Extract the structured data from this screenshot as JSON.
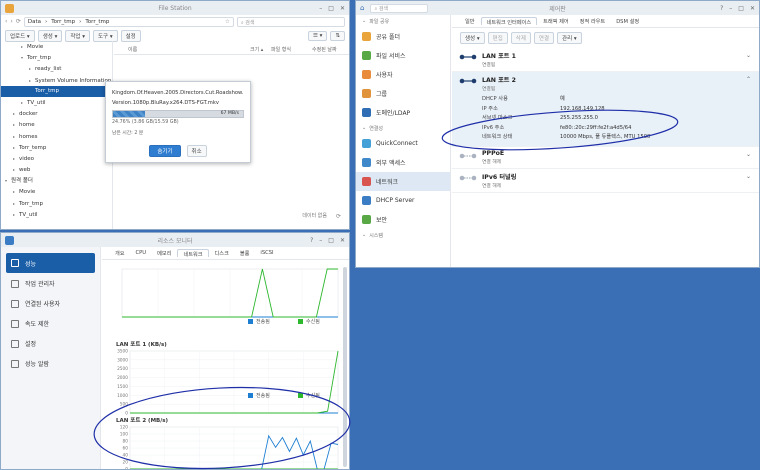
{
  "file_station": {
    "title": "File Station",
    "path": [
      "Data",
      "Torr_tmp",
      "Torr_tmp"
    ],
    "search_placeholder": "검색",
    "toolbar": [
      "업로드 ▾",
      "생성 ▾",
      "작업 ▾",
      "도구 ▾",
      "설정"
    ],
    "columns": [
      "이름",
      "크기 ▴",
      "파일 형식",
      "수정된 날짜"
    ],
    "tree": [
      {
        "label": "Movie",
        "indent": 1,
        "arrow": "▸"
      },
      {
        "label": "Torr_tmp",
        "indent": 1,
        "arrow": "▾"
      },
      {
        "label": "ready_list",
        "indent": 2,
        "arrow": "▸"
      },
      {
        "label": "System Volume Information",
        "indent": 2,
        "arrow": "▸"
      },
      {
        "label": "Torr_tmp",
        "indent": 2,
        "arrow": "",
        "selected": true
      },
      {
        "label": "TV_util",
        "indent": 1,
        "arrow": "▸"
      },
      {
        "label": "docker",
        "indent": 0,
        "arrow": "▸"
      },
      {
        "label": "home",
        "indent": 0,
        "arrow": "▸"
      },
      {
        "label": "homes",
        "indent": 0,
        "arrow": "▸"
      },
      {
        "label": "Torr_temp",
        "indent": 0,
        "arrow": "▸"
      },
      {
        "label": "video",
        "indent": 0,
        "arrow": "▸"
      },
      {
        "label": "web",
        "indent": 0,
        "arrow": "▸"
      },
      {
        "label": "원격 폴더",
        "indent": -1,
        "arrow": "▾"
      },
      {
        "label": "Movie",
        "indent": 0,
        "arrow": "▸"
      },
      {
        "label": "Torr_tmp",
        "indent": 0,
        "arrow": "▸"
      },
      {
        "label": "TV_util",
        "indent": 0,
        "arrow": "▸"
      }
    ],
    "footer": "데이터 없음",
    "dialog": {
      "filename": "Kingdom.Of.Heaven.2005.Directors.Cut.Roadshow.Version.1080p.BluRay.x264.DTS-FGT.mkv",
      "progress": 0.2476,
      "progress_text": "24.76% (3.86 GB/15.59 GB)",
      "speed": "67 MB/s",
      "remaining": "남은 시간: 2 분",
      "hide": "숨기기",
      "cancel": "취소"
    }
  },
  "control_panel": {
    "title": "제어판",
    "search_placeholder": "검색",
    "sidebar": [
      {
        "label": "파일 공유",
        "section": true
      },
      {
        "label": "공유 폴더",
        "color": "#e9a43b"
      },
      {
        "label": "파일 서비스",
        "color": "#58a845"
      },
      {
        "label": "사용자",
        "color": "#e88b3a"
      },
      {
        "label": "그룹",
        "color": "#e0933b"
      },
      {
        "label": "도메인/LDAP",
        "color": "#2f6eb5"
      },
      {
        "label": "연결성",
        "section": true
      },
      {
        "label": "QuickConnect",
        "color": "#44a1d8"
      },
      {
        "label": "외부 액세스",
        "color": "#3f88c9"
      },
      {
        "label": "네트워크",
        "color": "#d9534f",
        "selected": true
      },
      {
        "label": "DHCP Server",
        "color": "#3b7dc4"
      },
      {
        "label": "보안",
        "color": "#58a845"
      },
      {
        "label": "시스템",
        "section": true
      }
    ],
    "tabs": [
      "일반",
      "네트워크 인터페이스",
      "트래픽 제어",
      "정적 라우트",
      "DSM 설정"
    ],
    "actions": [
      "생성 ▾",
      "편집",
      "삭제",
      "연결",
      "관리 ▾"
    ],
    "interfaces": [
      {
        "name": "LAN 포트 1",
        "status": "연결됨",
        "expanded": false
      },
      {
        "name": "LAN 포트 2",
        "status": "연결됨",
        "expanded": true,
        "details": [
          {
            "k": "DHCP 사용",
            "v": "예"
          },
          {
            "k": "IP 주소",
            "v": "192.168.149.128"
          },
          {
            "k": "서브넷 마스크",
            "v": "255.255.255.0"
          },
          {
            "k": "IPv6 주소",
            "v": "fe80::20c:29ff:fe2f:a4d5/64"
          },
          {
            "k": "네트워크 상태",
            "v": "10000 Mbps, 풀 듀플렉스, MTU 1500"
          }
        ]
      },
      {
        "name": "PPPoE",
        "status": "연결 해제",
        "expanded": false
      },
      {
        "name": "IPv6 터널링",
        "status": "연결 해제",
        "expanded": false
      }
    ]
  },
  "resource_monitor": {
    "title": "리소스 모니터",
    "sidebar": [
      "성능",
      "작업 관리자",
      "연결된 사용자",
      "속도 제한",
      "설정",
      "성능 알람"
    ],
    "tabs": [
      "개요",
      "CPU",
      "메모리",
      "네트워크",
      "디스크",
      "볼륨",
      "iSCSI"
    ],
    "legend": {
      "send": "전송됨",
      "recv": "수신됨"
    },
    "colors": {
      "send": "#1e7fd2",
      "recv": "#2eb82e"
    }
  },
  "chart_data": [
    {
      "type": "line",
      "title": "",
      "x": [
        0,
        1,
        2,
        3,
        4,
        5,
        6,
        7,
        8,
        9,
        10,
        11,
        12,
        13,
        14,
        15,
        16,
        17,
        18,
        19,
        20
      ],
      "series": [
        {
          "name": "전송됨",
          "values": [
            0,
            0,
            0,
            0,
            0,
            0,
            0,
            0,
            0,
            0,
            0,
            0,
            0,
            0,
            0,
            0,
            0,
            0,
            0,
            0,
            0
          ]
        },
        {
          "name": "수신됨",
          "values": [
            0,
            0,
            0,
            0,
            0,
            0,
            0,
            0,
            0,
            0,
            0,
            0,
            0,
            1,
            0,
            0,
            0,
            0,
            0,
            1,
            1
          ]
        }
      ]
    },
    {
      "type": "line",
      "title": "LAN 포트 1 (KB/s)",
      "yticks": [
        0,
        500,
        1000,
        1500,
        2000,
        2500,
        3000,
        3500
      ],
      "ylim": [
        0,
        3500
      ],
      "x": [
        0,
        1,
        2,
        3,
        4,
        5,
        6,
        7,
        8,
        9,
        10,
        11,
        12,
        13,
        14,
        15,
        16,
        17,
        18,
        19,
        20
      ],
      "series": [
        {
          "name": "전송됨",
          "values": [
            0,
            0,
            0,
            0,
            0,
            0,
            0,
            0,
            0,
            0,
            0,
            0,
            0,
            0,
            0,
            0,
            0,
            0,
            0,
            0,
            0
          ]
        },
        {
          "name": "수신됨",
          "values": [
            0,
            0,
            0,
            0,
            0,
            0,
            0,
            0,
            0,
            0,
            0,
            0,
            0,
            0,
            0,
            0,
            0,
            0,
            0,
            100,
            3500
          ]
        }
      ]
    },
    {
      "type": "line",
      "title": "LAN 포트 2 (MB/s)",
      "yticks": [
        0,
        20,
        40,
        60,
        80,
        100,
        120
      ],
      "ylim": [
        0,
        120
      ],
      "x": [
        0,
        1,
        2,
        3,
        4,
        5,
        6,
        7,
        8,
        9,
        10,
        11,
        12,
        13,
        14,
        15,
        16,
        17,
        18,
        19,
        20,
        21,
        22,
        23,
        24,
        25,
        26,
        27,
        28,
        29,
        30
      ],
      "series": [
        {
          "name": "전송됨",
          "values": [
            0,
            0,
            0,
            0,
            0,
            0,
            0,
            0,
            0,
            0,
            0,
            0,
            0,
            0,
            0,
            0,
            0,
            0,
            0,
            0,
            95,
            62,
            90,
            50,
            88,
            40,
            80,
            0,
            0,
            74,
            70
          ]
        },
        {
          "name": "수신됨",
          "values": [
            0,
            0,
            0,
            0,
            0,
            0,
            0,
            0,
            0,
            0,
            0,
            0,
            0,
            0,
            0,
            0,
            0,
            0,
            0,
            0,
            0,
            0,
            0,
            0,
            0,
            0,
            0,
            0,
            0,
            0,
            0
          ]
        }
      ]
    }
  ]
}
